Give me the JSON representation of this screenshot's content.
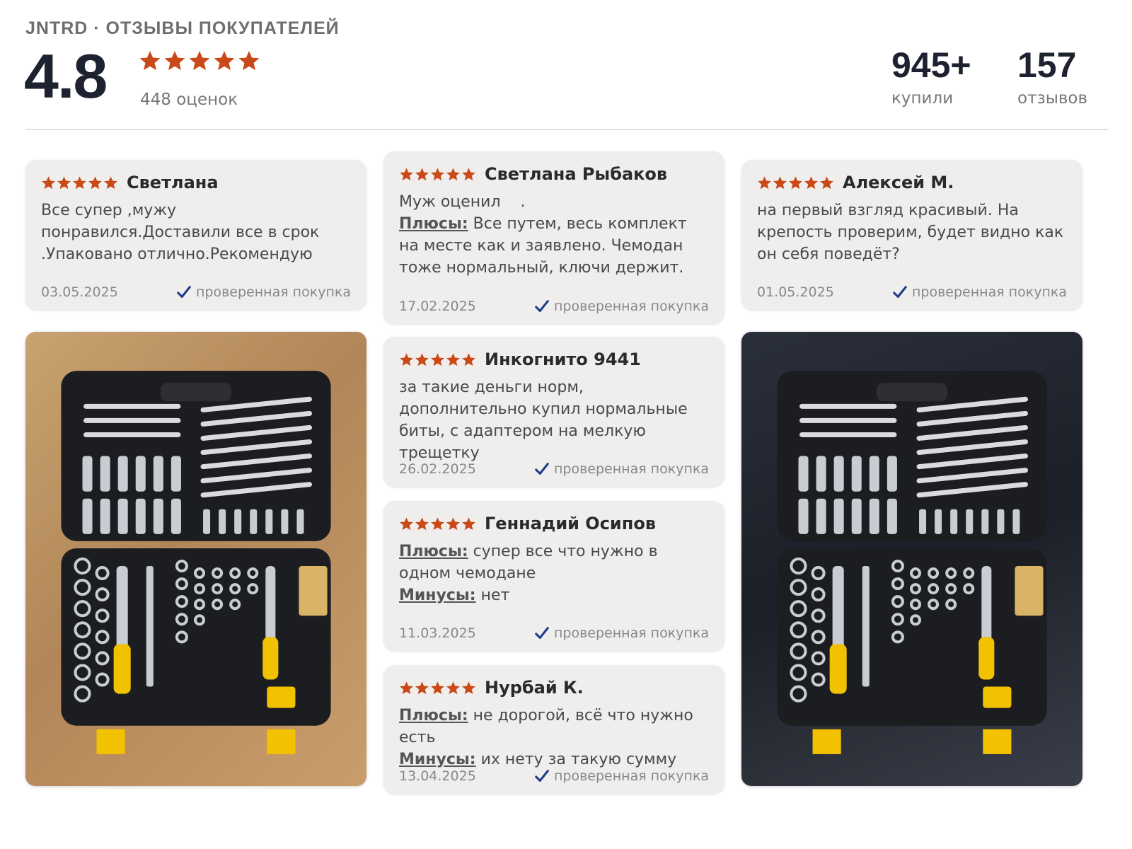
{
  "header": {
    "brand_line": "JNTRD · ОТЗЫВЫ ПОКУПАТЕЛЕЙ",
    "rating": "4.8",
    "rating_count": "448 оценок",
    "bought_value": "945+",
    "bought_label": "купили",
    "reviews_value": "157",
    "reviews_label": "отзывов"
  },
  "verified_label": "проверенная покупка",
  "colors": {
    "star": "#c94a18",
    "check": "#1f3b8a",
    "card": "#efeeec"
  },
  "reviews": [
    {
      "author": "Светлана",
      "text": "Все супер ,мужу понравился.Доставили все в срок .Упаковано отлично.Рекомендую",
      "date": "03.05.2025"
    },
    {
      "author": "Светлана Рыбаков",
      "text": "Муж оценил    .",
      "pros_label": "Плюсы:",
      "pros": "Все путем, весь комплект на месте как и заявлено. Чемодан тоже нормальный, ключи держит.",
      "date": "17.02.2025"
    },
    {
      "author": "Алексей М.",
      "text": "на первый взгляд красивый. На крепость проверим, будет видно как он себя поведёт?",
      "date": "01.05.2025"
    },
    {
      "author": "Инкогнито 9441",
      "text": "за такие деньги норм, дополнительно купил нормальные биты, с адаптером на мелкую трещетку",
      "date": "26.02.2025"
    },
    {
      "author": "Геннадий Осипов",
      "pros_label": "Плюсы:",
      "pros": "супер все что нужно в одном чемодане",
      "cons_label": "Минусы:",
      "cons": "нет",
      "date": "11.03.2025"
    },
    {
      "author": "Нурбай К.",
      "pros_label": "Плюсы:",
      "pros": "не дорогой, всё что нужно есть",
      "cons_label": "Минусы:",
      "cons": "их нету за такую сумму",
      "date": "13.04.2025"
    }
  ],
  "photos": [
    {
      "alt": "Фото набора инструментов на деревянном полу"
    },
    {
      "alt": "Фото набора инструментов в тёмном интерьере"
    }
  ]
}
